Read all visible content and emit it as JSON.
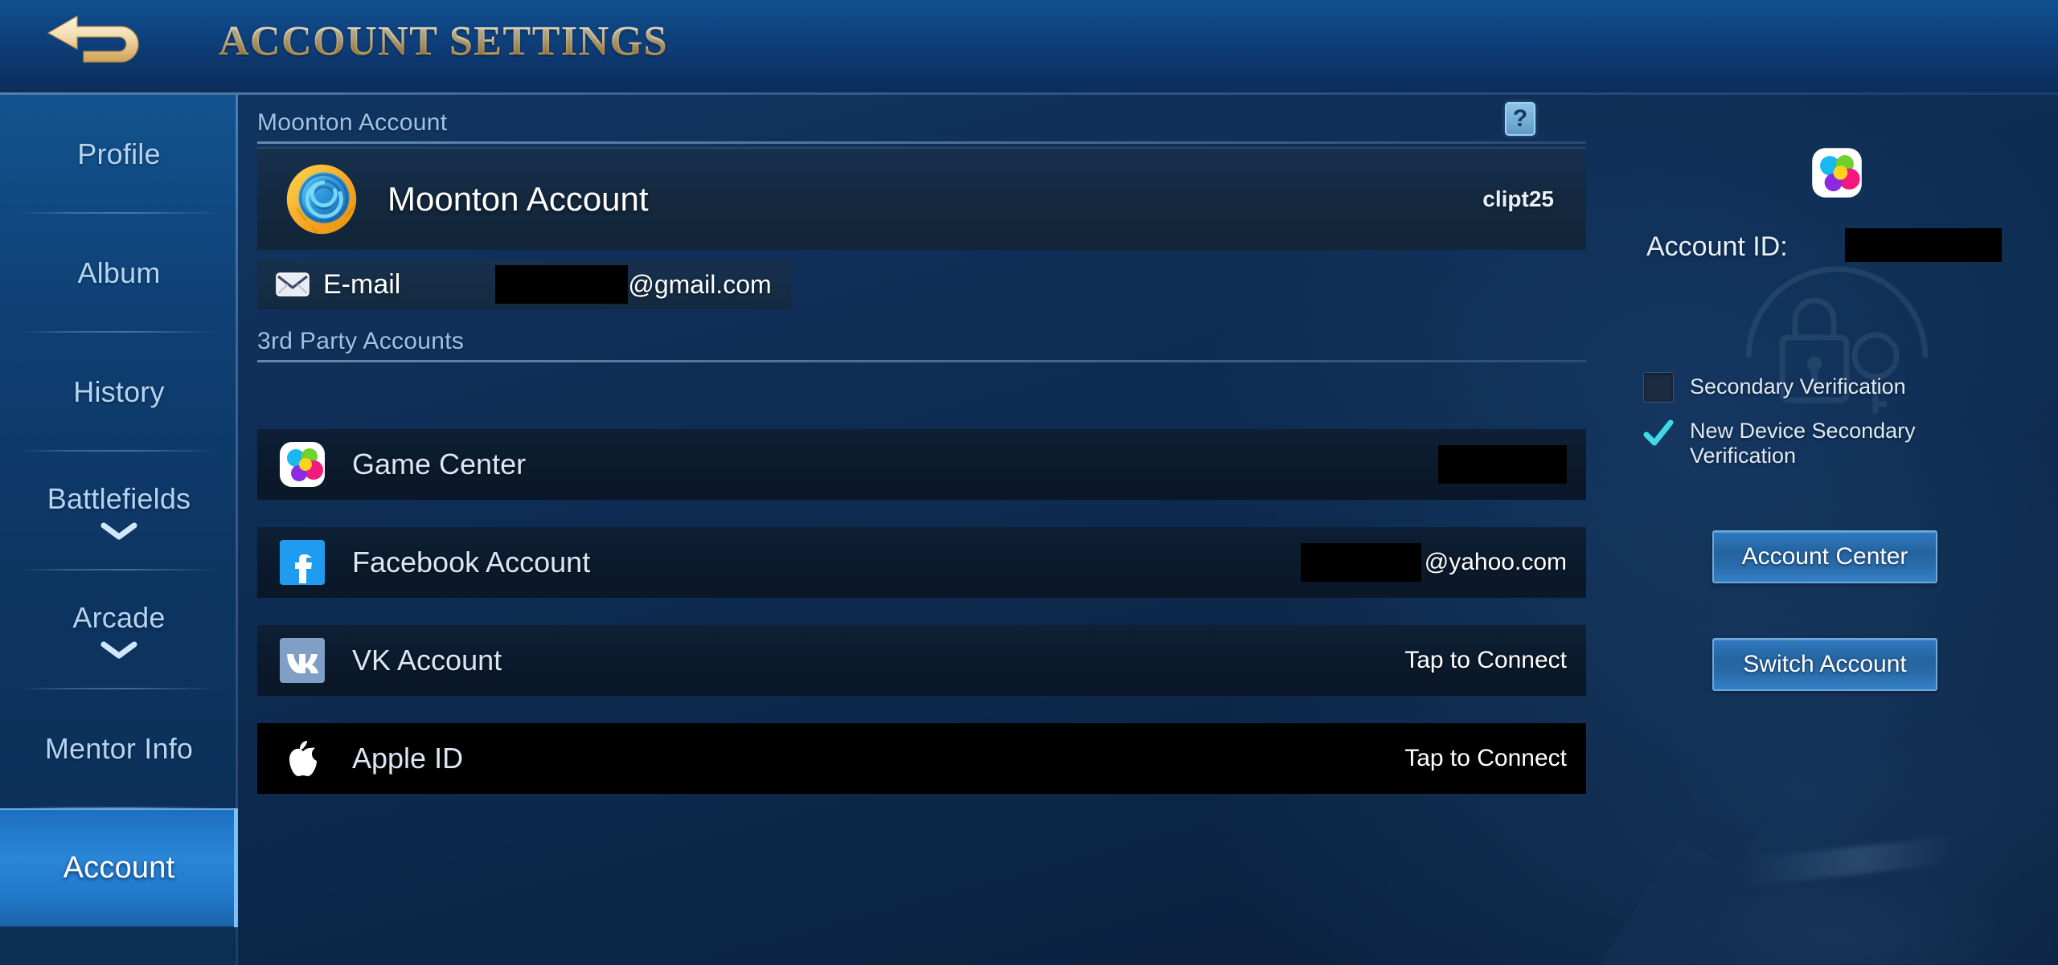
{
  "header": {
    "title": "ACCOUNT SETTINGS",
    "back_icon": "back-arrow-icon"
  },
  "sidebar": {
    "items": [
      {
        "label": "Profile",
        "active": false,
        "caret": false
      },
      {
        "label": "Album",
        "active": false,
        "caret": false
      },
      {
        "label": "History",
        "active": false,
        "caret": false
      },
      {
        "label": "Battlefields",
        "active": false,
        "caret": true
      },
      {
        "label": "Arcade",
        "active": false,
        "caret": true
      },
      {
        "label": "Mentor Info",
        "active": false,
        "caret": false
      },
      {
        "label": "Account",
        "active": true,
        "caret": false
      }
    ]
  },
  "main": {
    "moonton_section_title": "Moonton Account",
    "help_icon_label": "?",
    "moonton_account": {
      "icon": "moonton-spiral-logo-icon",
      "name": "Moonton Account",
      "username": "clipt25"
    },
    "email_row": {
      "icon": "envelope-icon",
      "label": "E-mail",
      "value_redacted": true,
      "domain": "@gmail.com"
    },
    "third_party_title": "3rd Party Accounts",
    "third_party_accounts": [
      {
        "icon": "game-center-icon",
        "label": "Game Center",
        "value": "",
        "redacted": true,
        "style": "dark"
      },
      {
        "icon": "facebook-icon",
        "label": "Facebook Account",
        "value": "@yahoo.com",
        "redacted": true,
        "style": "dark"
      },
      {
        "icon": "vk-icon",
        "label": "VK Account",
        "value": "Tap to Connect",
        "redacted": false,
        "style": "dark"
      },
      {
        "icon": "apple-icon",
        "label": "Apple ID",
        "value": "Tap to Connect",
        "redacted": false,
        "style": "black"
      }
    ]
  },
  "right_panel": {
    "avatar_icon": "game-center-avatar-icon",
    "account_id_label": "Account ID:",
    "account_id_redacted": true,
    "checkboxes": [
      {
        "label": "Secondary Verification",
        "checked": false
      },
      {
        "label": "New Device Secondary Verification",
        "checked": true
      }
    ],
    "buttons": [
      {
        "label": "Account Center"
      },
      {
        "label": "Switch Account"
      }
    ]
  },
  "colors": {
    "accent_gold": "#e6c173",
    "accent_blue": "#2a86d8",
    "check_cyan": "#3fd9e8",
    "panel_dark": "#0e2036",
    "row_black": "#000000"
  }
}
